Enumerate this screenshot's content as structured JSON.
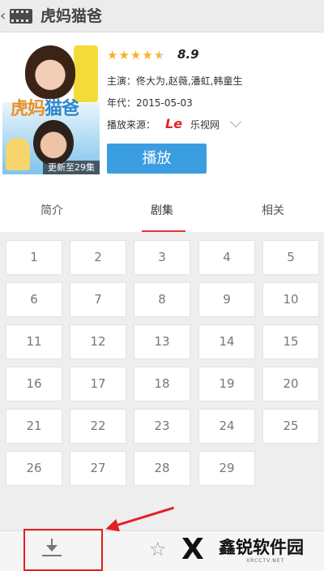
{
  "header": {
    "back_glyph": "‹",
    "title": "虎妈猫爸"
  },
  "poster": {
    "logo_a": "虎妈",
    "logo_b": "猫爸",
    "badge": "更新至29集"
  },
  "details": {
    "stars_filled": 4.5,
    "stars_total": 5,
    "rating": "8.9",
    "cast": "主演：佟大为,赵薇,潘虹,韩童生",
    "year": "年代：2015-05-03",
    "source_label": "播放来源：",
    "source_logo": "Le",
    "source_name": "乐视网"
  },
  "actions": {
    "play_label": "播放"
  },
  "tabs": [
    {
      "label": "简介"
    },
    {
      "label": "剧集",
      "active": true
    },
    {
      "label": "相关"
    }
  ],
  "episodes": [
    "1",
    "2",
    "3",
    "4",
    "5",
    "6",
    "7",
    "8",
    "9",
    "10",
    "11",
    "12",
    "13",
    "14",
    "15",
    "16",
    "17",
    "18",
    "19",
    "20",
    "21",
    "22",
    "23",
    "24",
    "25",
    "26",
    "27",
    "28",
    "29"
  ],
  "bottom_bar": {
    "icons": [
      "download-icon",
      "star-icon"
    ]
  },
  "annotation": {
    "color": "#e31e24"
  },
  "watermark": {
    "mark": "X",
    "name": "鑫锐软件园",
    "site": "XRCCTV.NET"
  },
  "colors": {
    "accent_blue": "#3a9de0",
    "tab_active": "#e3343a",
    "star_on": "#f5b324"
  }
}
